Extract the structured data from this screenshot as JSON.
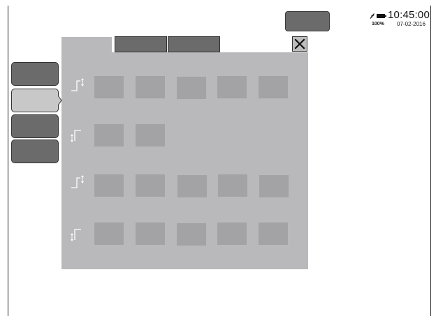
{
  "status": {
    "time": "10:45:00",
    "battery_percent": "100%",
    "date": "07-02-2016",
    "icons": [
      "plug-icon",
      "battery-icon"
    ]
  },
  "toolbar": {
    "top_button_label": "",
    "tabs": [
      {
        "label": ""
      },
      {
        "label": ""
      }
    ],
    "close_icon": "close-icon"
  },
  "sidebar": {
    "items": [
      {
        "label": "",
        "selected": false
      },
      {
        "label": "",
        "selected": true
      },
      {
        "label": "",
        "selected": false
      },
      {
        "label": "",
        "selected": false
      }
    ]
  },
  "grid": {
    "rows": [
      {
        "icon": "step-up-icon",
        "cells": 5
      },
      {
        "icon": "step-down-icon",
        "cells": 2
      },
      {
        "icon": "step-up-icon",
        "cells": 5
      },
      {
        "icon": "step-down-icon",
        "cells": 5
      }
    ]
  },
  "colors": {
    "panel": "#b9b9bb",
    "cell": "#a3a3a5",
    "button_dark": "#6b6b6b",
    "button_selected": "#c8c8c8"
  }
}
